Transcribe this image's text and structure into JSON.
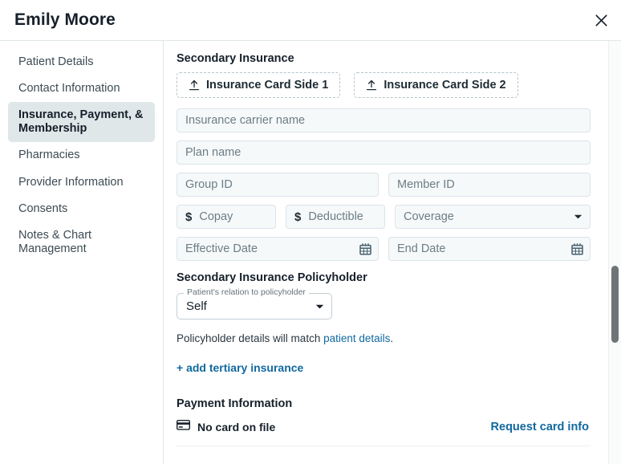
{
  "header": {
    "title": "Emily Moore",
    "close_label": "×"
  },
  "sidebar": {
    "items": [
      {
        "label": "Patient Details",
        "active": false
      },
      {
        "label": "Contact Information",
        "active": false
      },
      {
        "label": "Insurance, Payment, & Membership",
        "active": true
      },
      {
        "label": "Pharmacies",
        "active": false
      },
      {
        "label": "Provider Information",
        "active": false
      },
      {
        "label": "Consents",
        "active": false
      },
      {
        "label": "Notes & Chart Management",
        "active": false
      }
    ]
  },
  "main": {
    "secondary_insurance": {
      "heading": "Secondary Insurance",
      "upload_buttons": [
        {
          "label": "Insurance Card Side 1",
          "icon": "upload-icon"
        },
        {
          "label": "Insurance Card Side 2",
          "icon": "upload-icon"
        }
      ],
      "fields": {
        "carrier_name": {
          "placeholder": "Insurance carrier name",
          "value": ""
        },
        "plan_name": {
          "placeholder": "Plan name",
          "value": ""
        },
        "group_id": {
          "placeholder": "Group ID",
          "value": ""
        },
        "member_id": {
          "placeholder": "Member ID",
          "value": ""
        },
        "copay": {
          "placeholder": "Copay",
          "value": "",
          "prefix": "$"
        },
        "deductible": {
          "placeholder": "Deductible",
          "value": "",
          "prefix": "$"
        },
        "coverage": {
          "placeholder": "Coverage",
          "value": ""
        },
        "effective_date": {
          "placeholder": "Effective Date",
          "value": ""
        },
        "end_date": {
          "placeholder": "End Date",
          "value": ""
        }
      }
    },
    "policyholder": {
      "heading": "Secondary Insurance Policyholder",
      "relation_label": "Patient's relation to policyholder",
      "relation_value": "Self",
      "note_prefix": "Policyholder details will match ",
      "note_link": "patient details",
      "note_suffix": "."
    },
    "add_tertiary_label": "+ add tertiary insurance",
    "payment": {
      "heading": "Payment Information",
      "card_status": "No card on file",
      "card_icon": "credit-card-icon",
      "request_label": "Request card info"
    }
  },
  "colors": {
    "link": "#11689f",
    "active_nav_bg": "#dfe7e9",
    "input_bg": "#f6f9fa",
    "scrollbar_thumb": "#6f7477"
  }
}
